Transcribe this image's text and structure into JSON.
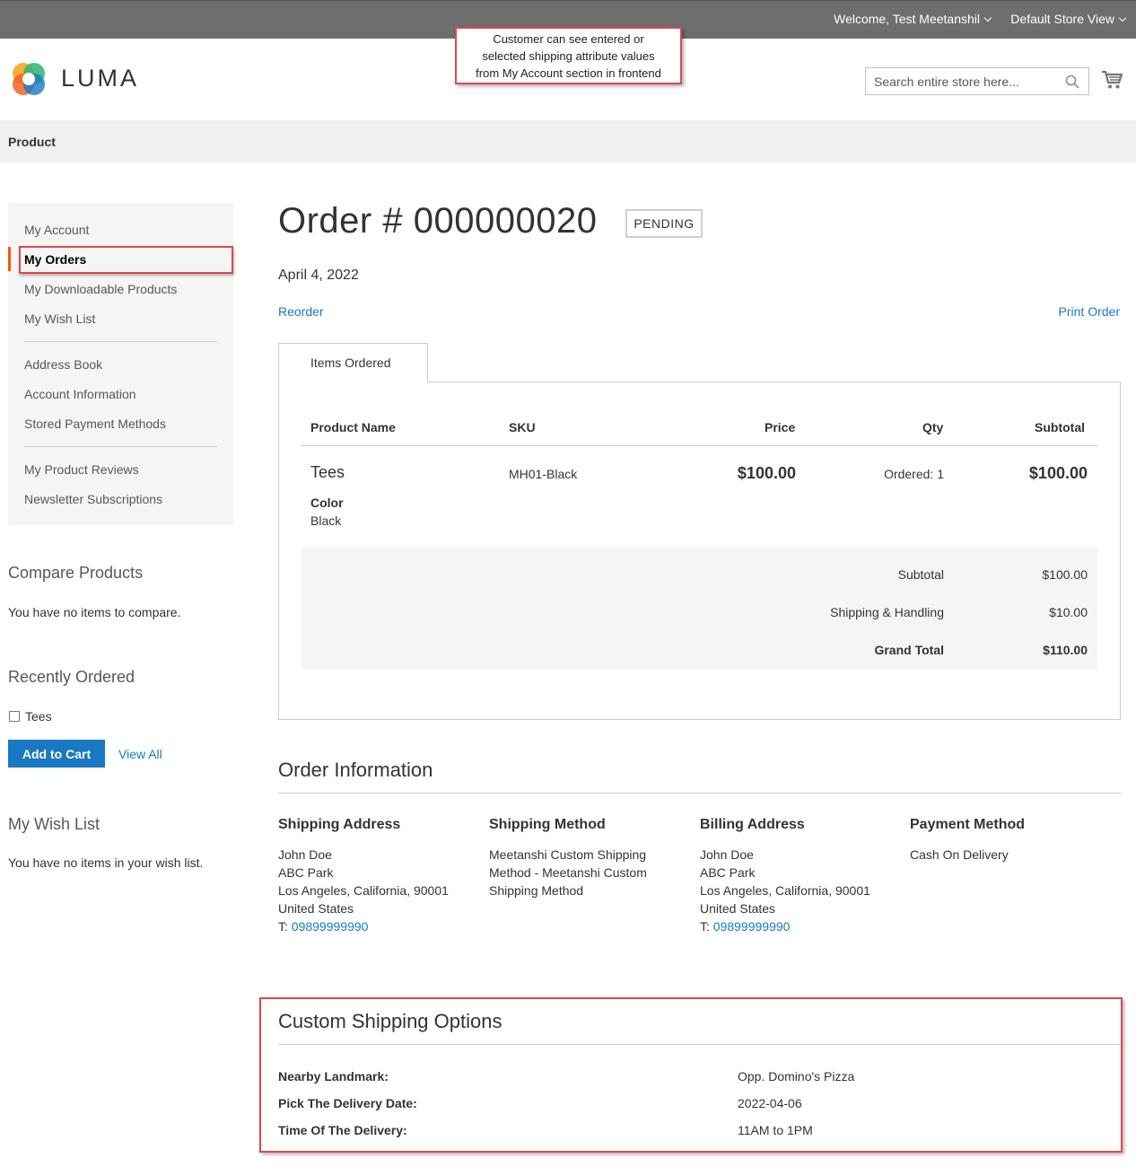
{
  "header": {
    "welcome": "Welcome, Test Meetanshil",
    "store_view": "Default Store View",
    "logo_text": "LUMA",
    "search_placeholder": "Search entire store here..."
  },
  "callout": {
    "line1": "Customer can see entered or",
    "line2": "selected shipping attribute values",
    "line3": "from My Account section in frontend"
  },
  "nav": {
    "item": "Product"
  },
  "sidebar": {
    "items": [
      {
        "label": "My Account"
      },
      {
        "label": "My Orders"
      },
      {
        "label": "My Downloadable Products"
      },
      {
        "label": "My Wish List"
      },
      {
        "label": "Address Book"
      },
      {
        "label": "Account Information"
      },
      {
        "label": "Stored Payment Methods"
      },
      {
        "label": "My Product Reviews"
      },
      {
        "label": "Newsletter Subscriptions"
      }
    ],
    "compare_title": "Compare Products",
    "compare_text": "You have no items to compare.",
    "recent_title": "Recently Ordered",
    "recent_item": "Tees",
    "add_to_cart": "Add to Cart",
    "view_all": "View All",
    "wishlist_title": "My Wish List",
    "wishlist_text": "You have no items in your wish list."
  },
  "order": {
    "title": "Order # 000000020",
    "status": "PENDING",
    "date": "April 4, 2022",
    "reorder": "Reorder",
    "print": "Print Order",
    "tab": "Items Ordered",
    "columns": {
      "name": "Product Name",
      "sku": "SKU",
      "price": "Price",
      "qty": "Qty",
      "subtotal": "Subtotal"
    },
    "item": {
      "name": "Tees",
      "option_label": "Color",
      "option_value": "Black",
      "sku": "MH01-Black",
      "price": "$100.00",
      "qty": "Ordered: 1",
      "subtotal": "$100.00"
    },
    "totals": {
      "subtotal_label": "Subtotal",
      "subtotal": "$100.00",
      "shipping_label": "Shipping & Handling",
      "shipping": "$10.00",
      "grand_label": "Grand Total",
      "grand": "$110.00"
    }
  },
  "info": {
    "title": "Order Information",
    "shipping_address": {
      "title": "Shipping Address",
      "name": "John Doe",
      "street": "ABC Park",
      "city": "Los Angeles, California, 90001",
      "country": "United States",
      "tel_prefix": "T: ",
      "tel": "09899999990"
    },
    "shipping_method": {
      "title": "Shipping Method",
      "line1": "Meetanshi Custom Shipping",
      "line2": "Method - Meetanshi Custom",
      "line3": "Shipping Method"
    },
    "billing_address": {
      "title": "Billing Address",
      "name": "John Doe",
      "street": "ABC Park",
      "city": "Los Angeles, California, 90001",
      "country": "United States",
      "tel_prefix": "T: ",
      "tel": "09899999990"
    },
    "payment_method": {
      "title": "Payment Method",
      "value": "Cash On Delivery"
    }
  },
  "custom": {
    "title": "Custom Shipping Options",
    "options": [
      {
        "label": "Nearby Landmark:",
        "value": "Opp. Domino's Pizza"
      },
      {
        "label": "Pick The Delivery Date:",
        "value": "2022-04-06"
      },
      {
        "label": "Time Of The Delivery:",
        "value": "11AM to 1PM"
      }
    ]
  },
  "colors": {
    "accent": "#1979c3",
    "active_bar": "#ff5501",
    "highlight": "#e2474b",
    "topbar": "#6e6e6e"
  }
}
